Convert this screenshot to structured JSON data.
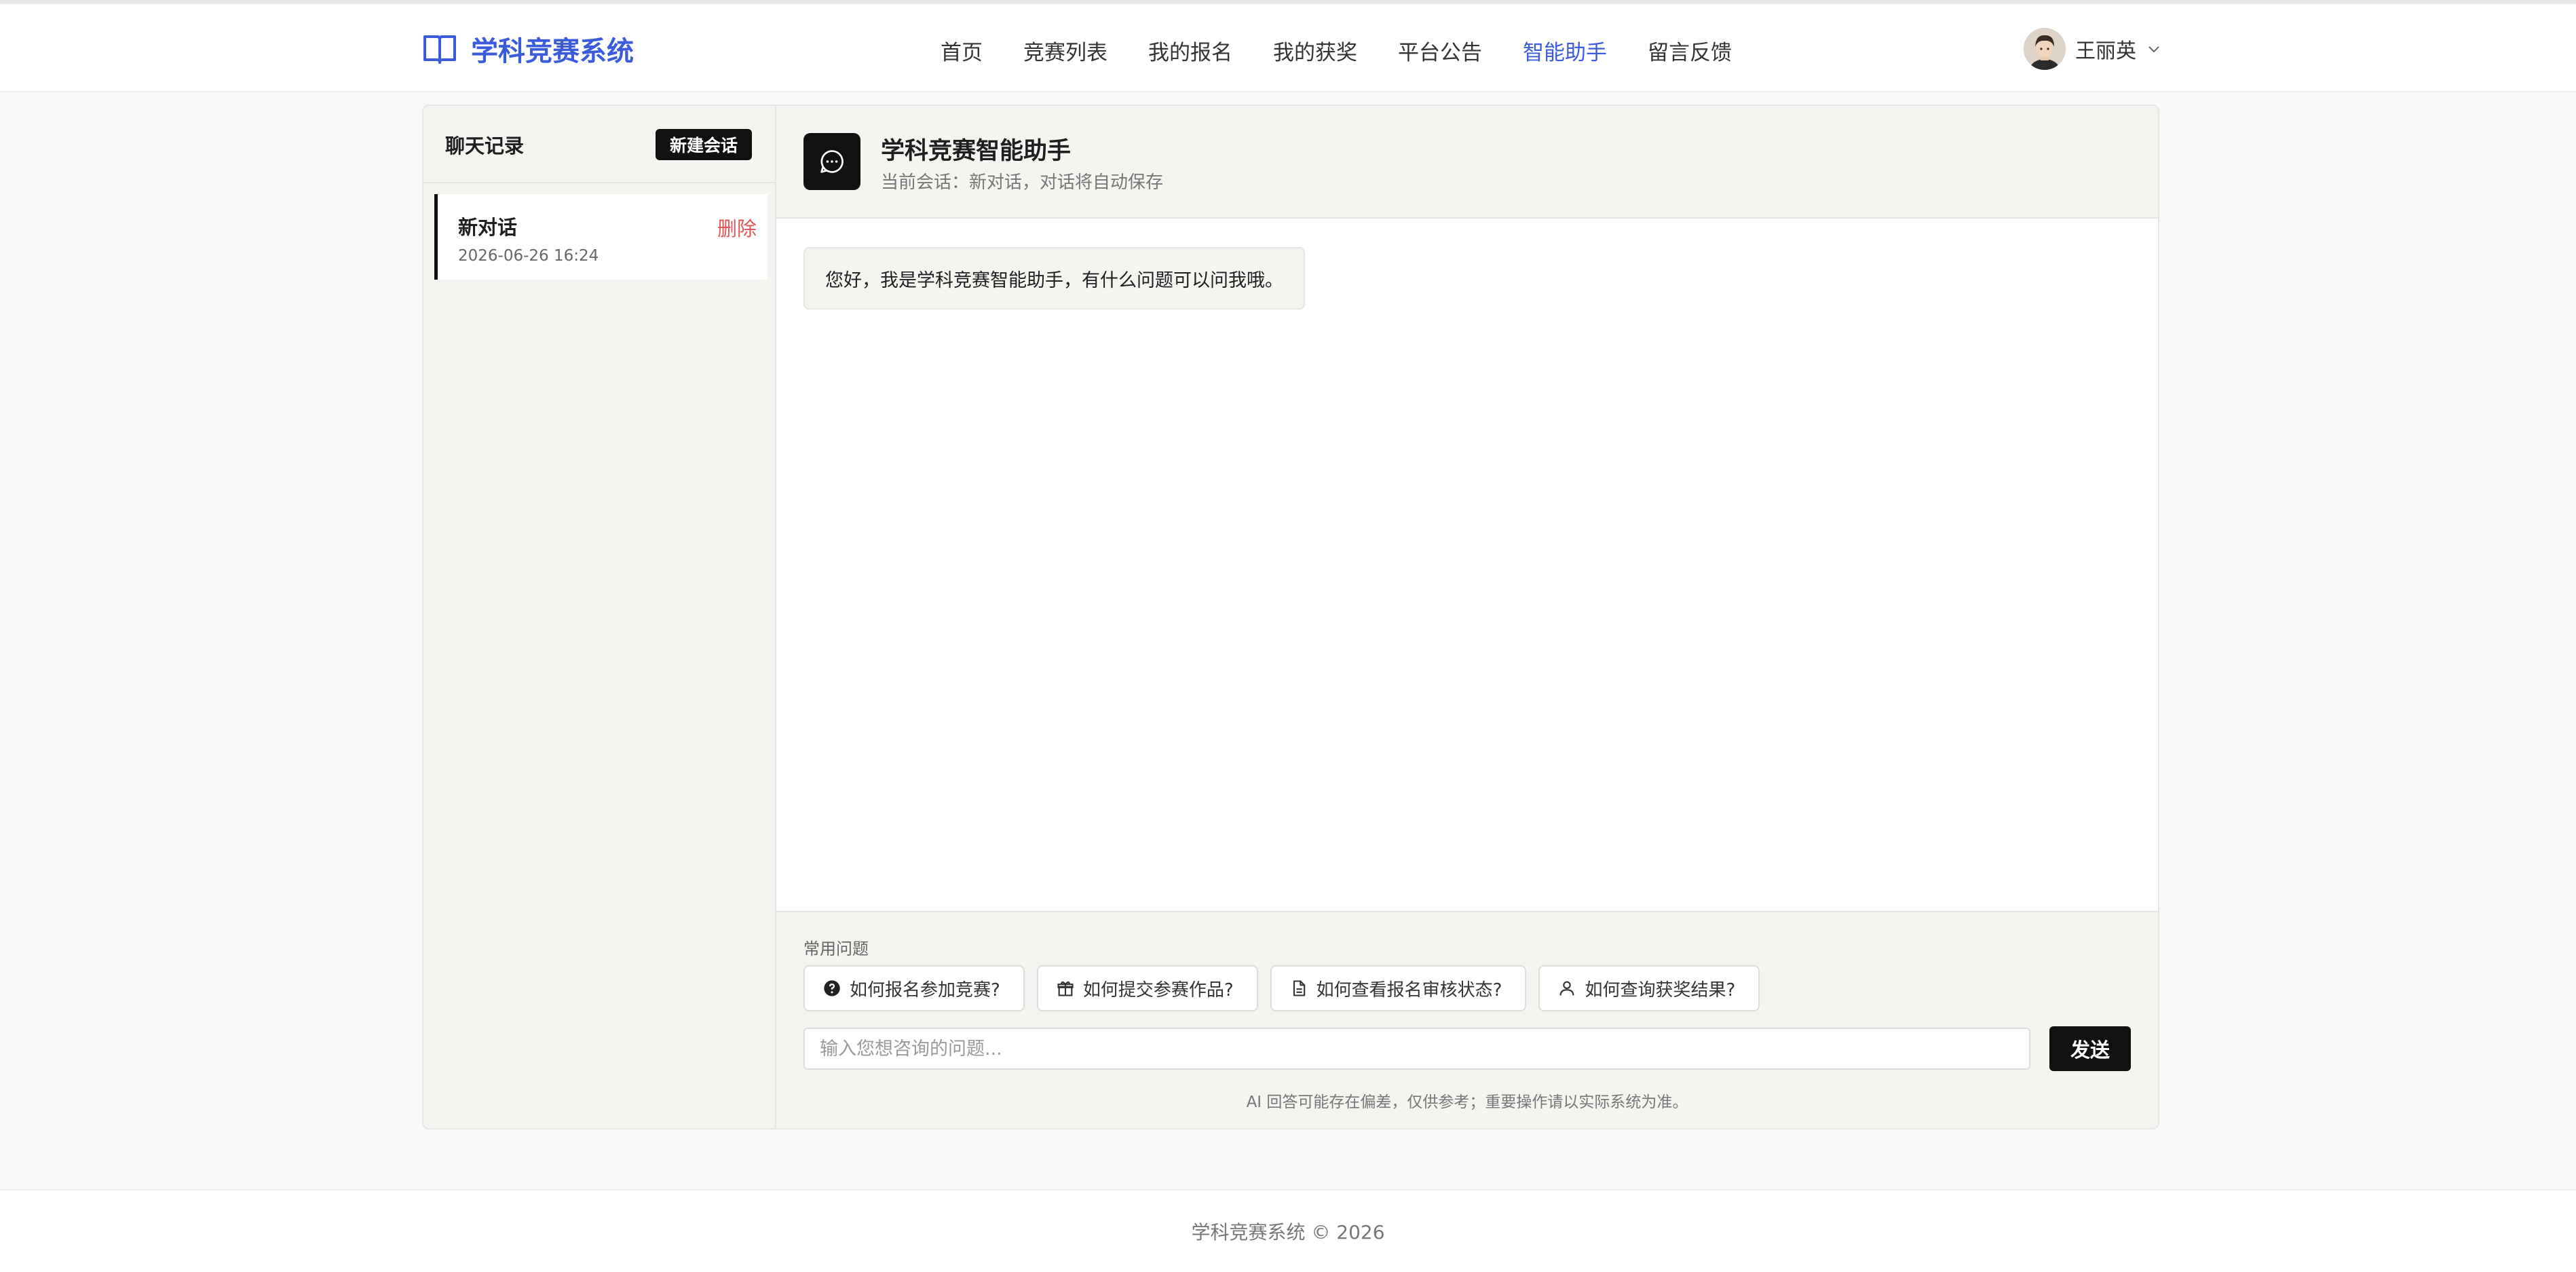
{
  "header": {
    "brand": "学科竞赛系统",
    "nav": [
      "首页",
      "竞赛列表",
      "我的报名",
      "我的获奖",
      "平台公告",
      "智能助手",
      "留言反馈"
    ],
    "active_nav": "智能助手",
    "user_name": "王丽英",
    "accent_color": "#3b5bdb"
  },
  "sidebar": {
    "title": "聊天记录",
    "new_button": "新建会话",
    "conversations": [
      {
        "title": "新对话",
        "time": "2026-06-26 16:24",
        "delete_label": "删除"
      }
    ]
  },
  "chat": {
    "title": "学科竞赛智能助手",
    "subtitle": "当前会话：新对话，对话将自动保存",
    "messages": [
      {
        "role": "assistant",
        "text": "您好，我是学科竞赛智能助手，有什么问题可以问我哦。"
      }
    ]
  },
  "composer": {
    "faq_label": "常用问题",
    "faqs": [
      {
        "icon": "question-circle-icon",
        "text": "如何报名参加竞赛?"
      },
      {
        "icon": "gift-icon",
        "text": "如何提交参赛作品?"
      },
      {
        "icon": "document-icon",
        "text": "如何查看报名审核状态?"
      },
      {
        "icon": "user-icon",
        "text": "如何查询获奖结果?"
      }
    ],
    "placeholder": "输入您想咨询的问题...",
    "send_label": "发送",
    "disclaimer": "AI 回答可能存在偏差，仅供参考；重要操作请以实际系统为准。"
  },
  "footer": {
    "text": "学科竞赛系统 © 2026"
  }
}
